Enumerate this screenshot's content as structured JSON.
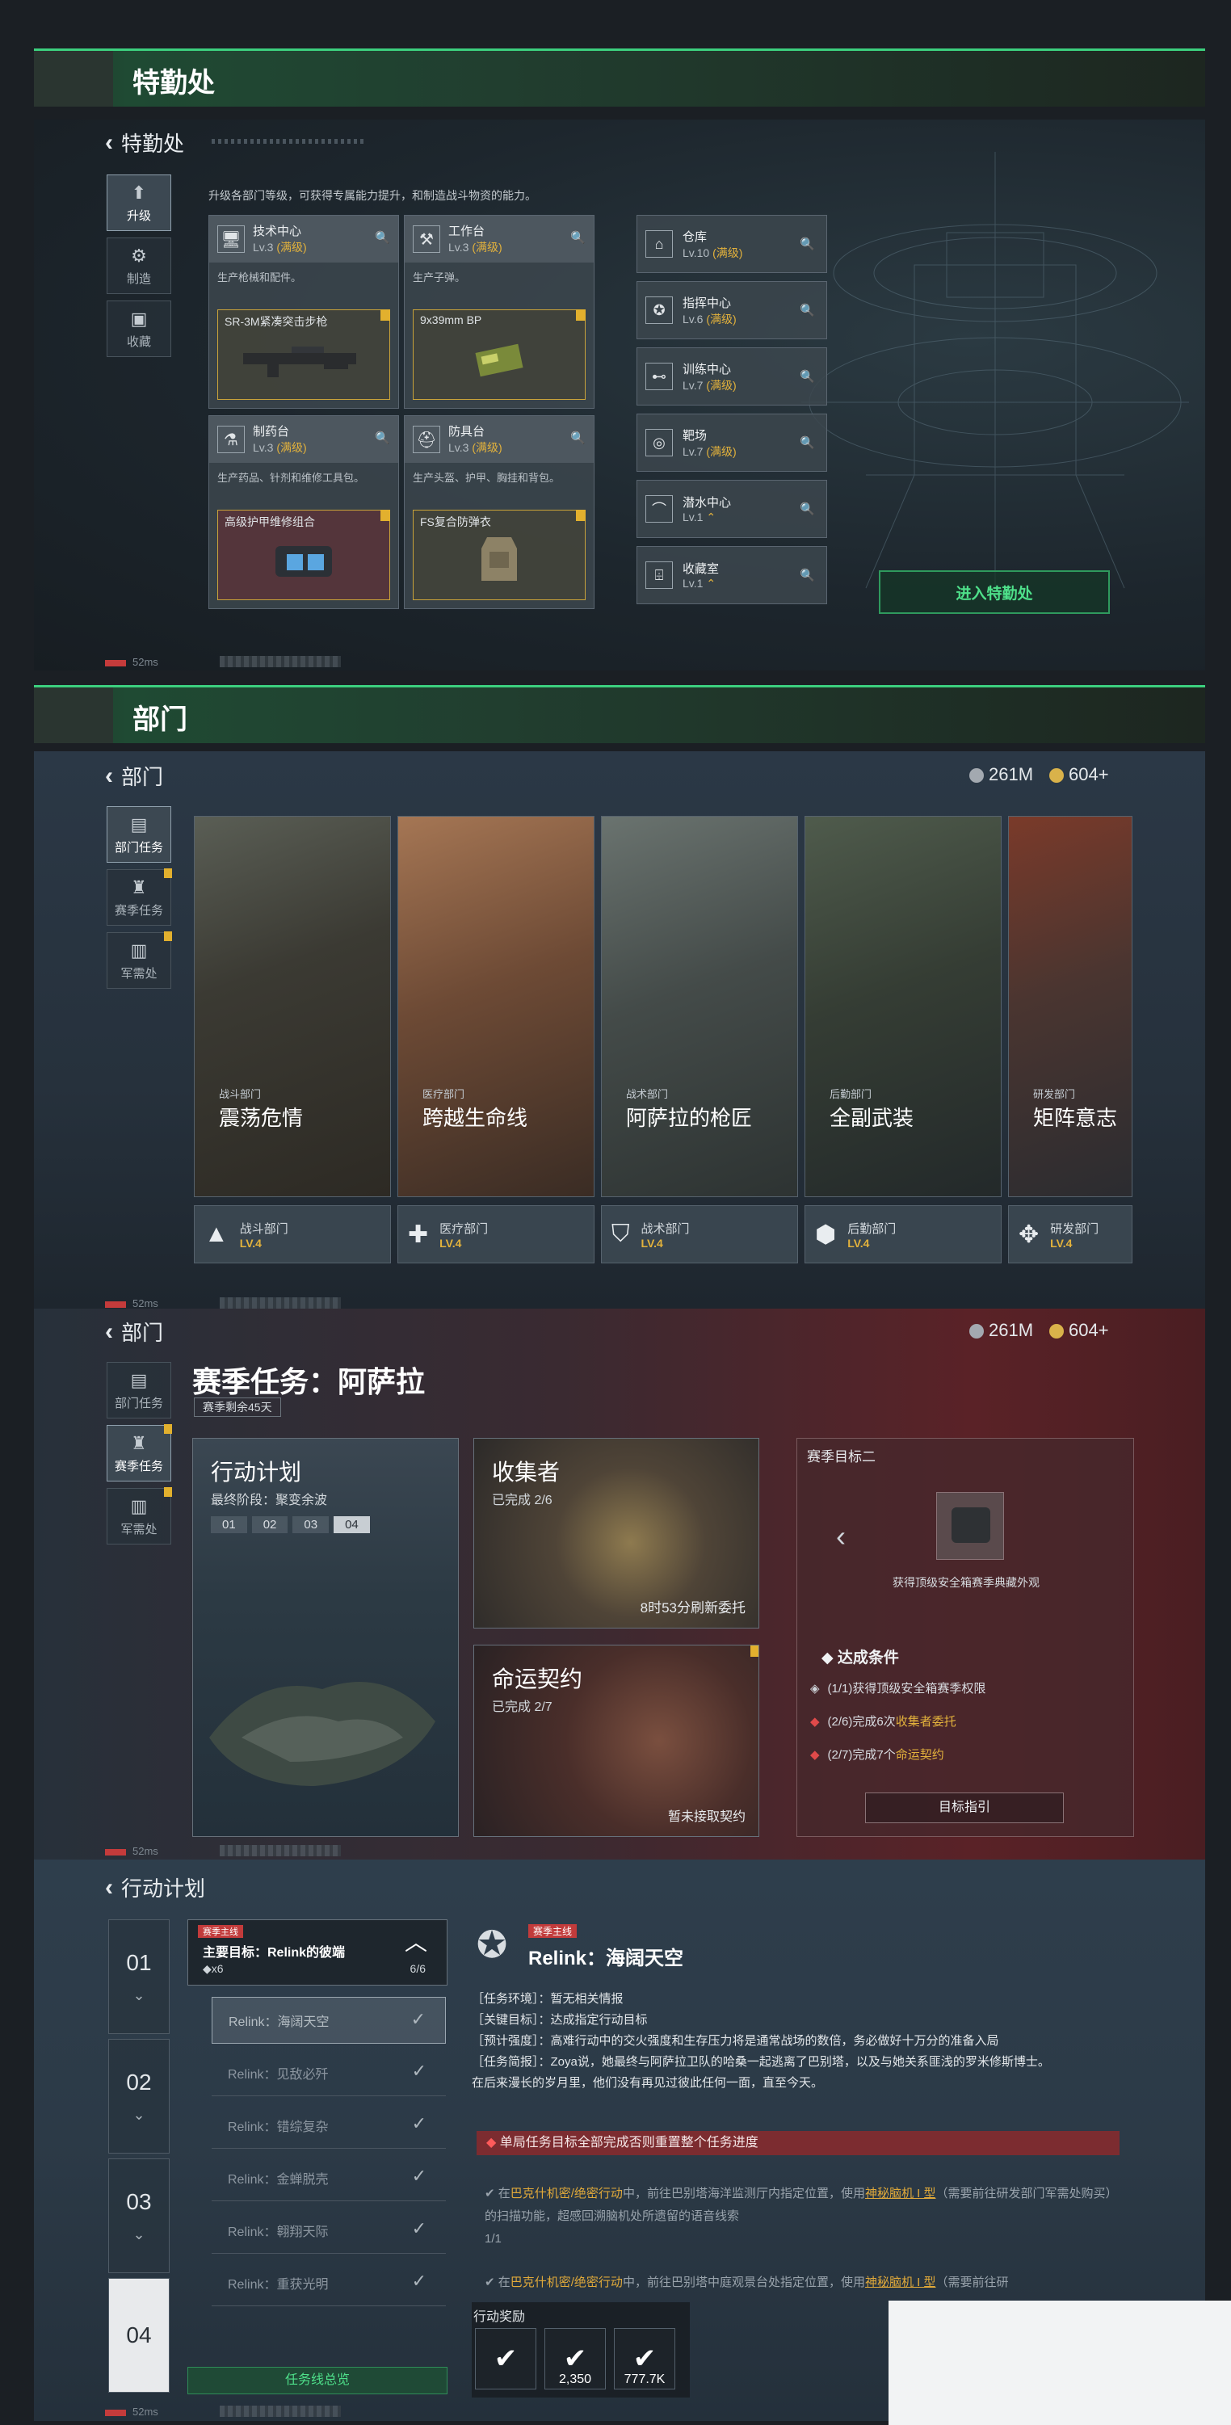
{
  "section1": {
    "banner": "特勤处",
    "back_title": "特勤处",
    "tabs": [
      {
        "label": "升级",
        "icon": "upgrade-icon"
      },
      {
        "label": "制造",
        "icon": "gear-icon"
      },
      {
        "label": "收藏",
        "icon": "collection-icon"
      }
    ],
    "description": "升级各部门等级，可获得专属能力提升，和制造战斗物资的能力。",
    "workshops": [
      {
        "name": "技术中心",
        "level": "Lv.3",
        "max": "(满级)",
        "desc": "生产枪械和配件。",
        "item": "SR-3M紧凑突击步枪",
        "icon": "monitor-icon",
        "red": false
      },
      {
        "name": "工作台",
        "level": "Lv.3",
        "max": "(满级)",
        "desc": "生产子弹。",
        "item": "9x39mm BP",
        "icon": "hammer-icon",
        "red": false
      },
      {
        "name": "制药台",
        "level": "Lv.3",
        "max": "(满级)",
        "desc": "生产药品、针剂和维修工具包。",
        "item": "高级护甲维修组合",
        "icon": "flask-icon",
        "red": true
      },
      {
        "name": "防具台",
        "level": "Lv.3",
        "max": "(满级)",
        "desc": "生产头盔、护甲、胸挂和背包。",
        "item": "FS复合防弹衣",
        "icon": "helmet-icon",
        "red": false
      }
    ],
    "facilities": [
      {
        "name": "仓库",
        "level": "Lv.10",
        "max": "(满级)",
        "icon": "warehouse-icon"
      },
      {
        "name": "指挥中心",
        "level": "Lv.6",
        "max": "(满级)",
        "icon": "command-icon"
      },
      {
        "name": "训练中心",
        "level": "Lv.7",
        "max": "(满级)",
        "icon": "dumbbell-icon"
      },
      {
        "name": "靶场",
        "level": "Lv.7",
        "max": "(满级)",
        "icon": "target-icon"
      },
      {
        "name": "潜水中心",
        "level": "Lv.1",
        "max": "",
        "icon": "dive-icon"
      },
      {
        "name": "收藏室",
        "level": "Lv.1",
        "max": "",
        "icon": "vault-icon"
      }
    ],
    "enter_button": "进入特勤处",
    "ping": "52ms"
  },
  "section2": {
    "banner": "部门",
    "back_title": "部门",
    "currency_a": "261M",
    "currency_b": "604+",
    "tabs": [
      {
        "label": "部门任务",
        "icon": "task-icon"
      },
      {
        "label": "赛季任务",
        "icon": "season-icon"
      },
      {
        "label": "军需处",
        "icon": "supply-icon"
      }
    ],
    "departments": [
      {
        "category": "战斗部门",
        "title": "震荡危情",
        "foot": "战斗部门",
        "level": "LV.4",
        "icon": "combat-icon",
        "bg": "linear-gradient(160deg,#5a5e55 0%,#3b3a33 40%,#2d2a24 100%)"
      },
      {
        "category": "医疗部门",
        "title": "跨越生命线",
        "foot": "医疗部门",
        "level": "LV.4",
        "icon": "medical-icon",
        "bg": "linear-gradient(160deg,#a57654 0%,#6d4a35 45%,#3a2c24 100%)"
      },
      {
        "category": "战术部门",
        "title": "阿萨拉的枪匠",
        "foot": "战术部门",
        "level": "LV.4",
        "icon": "tactical-icon",
        "bg": "linear-gradient(160deg,#6a736f 0%,#444b49 45%,#2d3332 100%)"
      },
      {
        "category": "后勤部门",
        "title": "全副武装",
        "foot": "后勤部门",
        "level": "LV.4",
        "icon": "logistics-icon",
        "bg": "linear-gradient(160deg,#4f5b4c 0%,#353d34 45%,#23292a 100%)"
      },
      {
        "category": "研发部门",
        "title": "矩阵意志",
        "foot": "研发部门",
        "level": "LV.4",
        "icon": "research-icon",
        "bg": "linear-gradient(160deg,#7a3a2a 0%,#4a3530 45%,#2b2c30 100%)"
      }
    ],
    "ping": "52ms"
  },
  "section3": {
    "back_title": "部门",
    "currency_a": "261M",
    "currency_b": "604+",
    "season_title": "赛季任务：阿萨拉",
    "remaining": "赛季剩余45天",
    "tabs": [
      {
        "label": "部门任务",
        "icon": "task-icon"
      },
      {
        "label": "赛季任务",
        "icon": "season-icon"
      },
      {
        "label": "军需处",
        "icon": "supply-icon"
      }
    ],
    "plan": {
      "title": "行动计划",
      "stage": "最终阶段：聚变余波",
      "steps": [
        "01",
        "02",
        "03",
        "04"
      ]
    },
    "collector": {
      "title": "收集者",
      "progress": "已完成 2/6",
      "refresh": "8时53分刷新委托"
    },
    "contract": {
      "title": "命运契约",
      "progress": "已完成 2/7",
      "status": "暂未接取契约"
    },
    "goal": {
      "header": "赛季目标二",
      "reward": "获得顶级安全箱赛季典藏外观",
      "cond_title": "达成条件",
      "conditions": [
        {
          "pre": "(1/1)获得顶级安全箱赛季权限",
          "hl": "",
          "post": ""
        },
        {
          "pre": "(2/6)完成6次",
          "hl": "收集者委托",
          "post": ""
        },
        {
          "pre": "(2/7)完成7个",
          "hl": "命运契约",
          "post": ""
        }
      ],
      "guide_button": "目标指引"
    },
    "ping": "52ms"
  },
  "section4": {
    "back_title": "行动计划",
    "stages": [
      "01",
      "02",
      "03",
      "04"
    ],
    "main_goal_tag": "赛季主线",
    "main_goal": "主要目标：Relink的彼端",
    "main_goal_count": "◆x6",
    "main_goal_progress": "6/6",
    "subtasks": [
      "Relink：海阔天空",
      "Relink：见敌必歼",
      "Relink：错综复杂",
      "Relink：金蝉脱壳",
      "Relink：翱翔天际",
      "Relink：重获光明"
    ],
    "overview_button": "任务线总览",
    "detail": {
      "tag": "赛季主线",
      "title": "Relink：海阔天空",
      "env": "［任务环境］：暂无相关情报",
      "key": "［关键目标］：达成指定行动目标",
      "intensity": "［预计强度］：高难行动中的交火强度和生存压力将是通常战场的数倍，务必做好十万分的准备入局",
      "brief": "［任务简报］：Zoya说，她最终与阿萨拉卫队的哈桑一起逃离了巴别塔，以及与她关系匪浅的罗米修斯博士。",
      "epilogue": "在后来漫长的岁月里，他们没有再见过彼此任何一面，直至今天。",
      "warning": "单局任务目标全部完成否则重置整个任务进度",
      "obj1_pre": "在",
      "obj1_map": "巴克什机密/绝密行动",
      "obj1_mid": "中，前往巴别塔海洋监测厅内指定位置，使用",
      "obj1_item": "神秘脑机 I 型",
      "obj1_post": "（需要前往研发部门军需处购买）的扫描功能，超感回溯脑机处所遗留的语音线索",
      "obj1_progress": "1/1",
      "obj2_pre": "在",
      "obj2_map": "巴克什机密/绝密行动",
      "obj2_mid": "中，前往巴别塔中庭观景台处指定位置，使用",
      "obj2_item": "神秘脑机 I 型",
      "obj2_post": "（需要前往研",
      "rewards_label": "行动奖励",
      "rewards": [
        "",
        "2,350",
        "777.7K"
      ]
    },
    "ping": "52ms"
  }
}
